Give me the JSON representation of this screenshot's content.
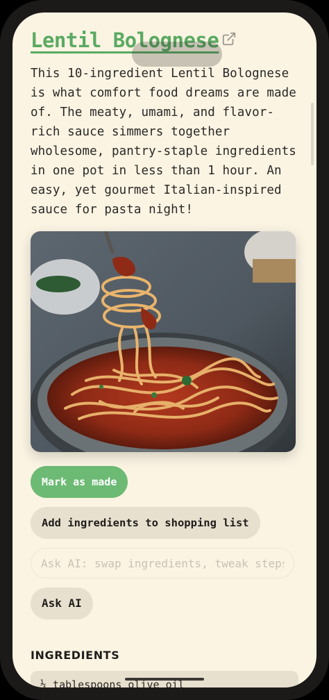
{
  "recipe": {
    "title": "Lentil Bolognese",
    "description": "This 10-ingredient Lentil Bolognese is what comfort food dreams are made of. The meaty, umami, and flavor-rich sauce simmers together wholesome, pantry-staple ingredients in one pot in less than 1 hour. An easy, yet gourmet Italian-inspired sauce for pasta night!"
  },
  "actions": {
    "mark_made_label": "Mark as made",
    "shopping_label": "Add ingredients to shopping list",
    "ai_placeholder": "Ask AI: swap ingredients, tweak steps...",
    "ask_ai_label": "Ask AI"
  },
  "ingredients": {
    "heading": "INGREDIENTS",
    "items": [
      {
        "text": "¼ tablespoons olive oil"
      }
    ]
  },
  "icons": {
    "external_link": "external-link-icon"
  },
  "colors": {
    "title_green": "#5aaa62",
    "primary_button": "#6cba74",
    "secondary_button": "#e8e0cf",
    "background": "#fbf4e3"
  }
}
